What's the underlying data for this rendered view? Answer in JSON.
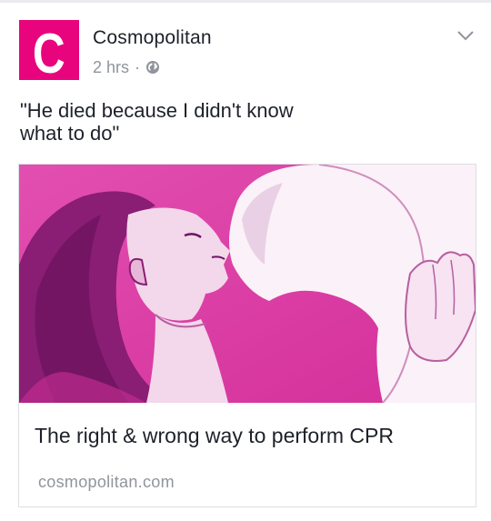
{
  "post": {
    "author": "Cosmopolitan",
    "logo_letter": "C",
    "timestamp": "2 hrs",
    "separator": "·",
    "privacy_icon": "globe-icon",
    "menu_icon": "chevron-down-icon",
    "text_line1": "\"He died because I didn't know",
    "text_line2": "what to do\""
  },
  "link_card": {
    "title": "The right & wrong way to perform CPR",
    "domain": "cosmopolitan.com"
  },
  "colors": {
    "brand_pink": "#e8047d",
    "illustration_pink": "#e044a8",
    "meta_gray": "#90949c",
    "text_dark": "#1d2129"
  }
}
